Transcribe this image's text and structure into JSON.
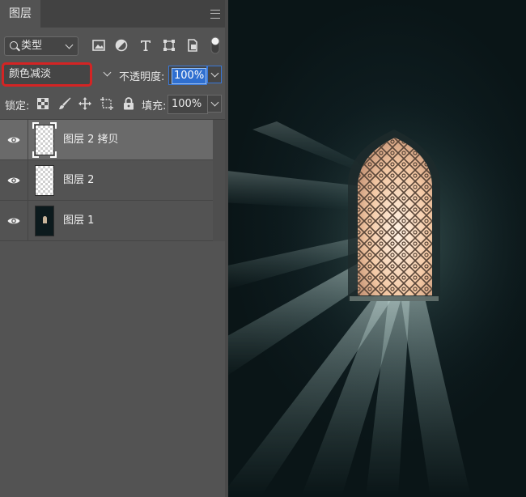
{
  "panel": {
    "tab_label": "图层",
    "filter": {
      "label": "类型"
    },
    "blend_mode": "颜色减淡",
    "opacity": {
      "label": "不透明度:",
      "value": "100%"
    },
    "lock": {
      "label": "锁定:"
    },
    "fill": {
      "label": "填充:",
      "value": "100%"
    },
    "layers": [
      {
        "name": "图层 2 拷贝",
        "selected": true,
        "thumb": "transparent"
      },
      {
        "name": "图层 2",
        "selected": false,
        "thumb": "transparent"
      },
      {
        "name": "图层 1",
        "selected": false,
        "thumb": "photo"
      }
    ]
  },
  "colors": {
    "panel_bg": "#535353",
    "selected_layer_bg": "#6a6a6a",
    "highlight_box": "#d42424",
    "focus_blue": "#3a78d8"
  },
  "icons": [
    "search-icon",
    "image-filter-icon",
    "adjustment-filter-icon",
    "text-filter-icon",
    "shape-filter-icon",
    "smart-object-filter-icon",
    "filter-toggle-icon",
    "lock-transparent-icon",
    "lock-paint-icon",
    "lock-position-icon",
    "lock-artboard-icon",
    "lock-all-icon",
    "eye-icon",
    "panel-menu-icon"
  ]
}
